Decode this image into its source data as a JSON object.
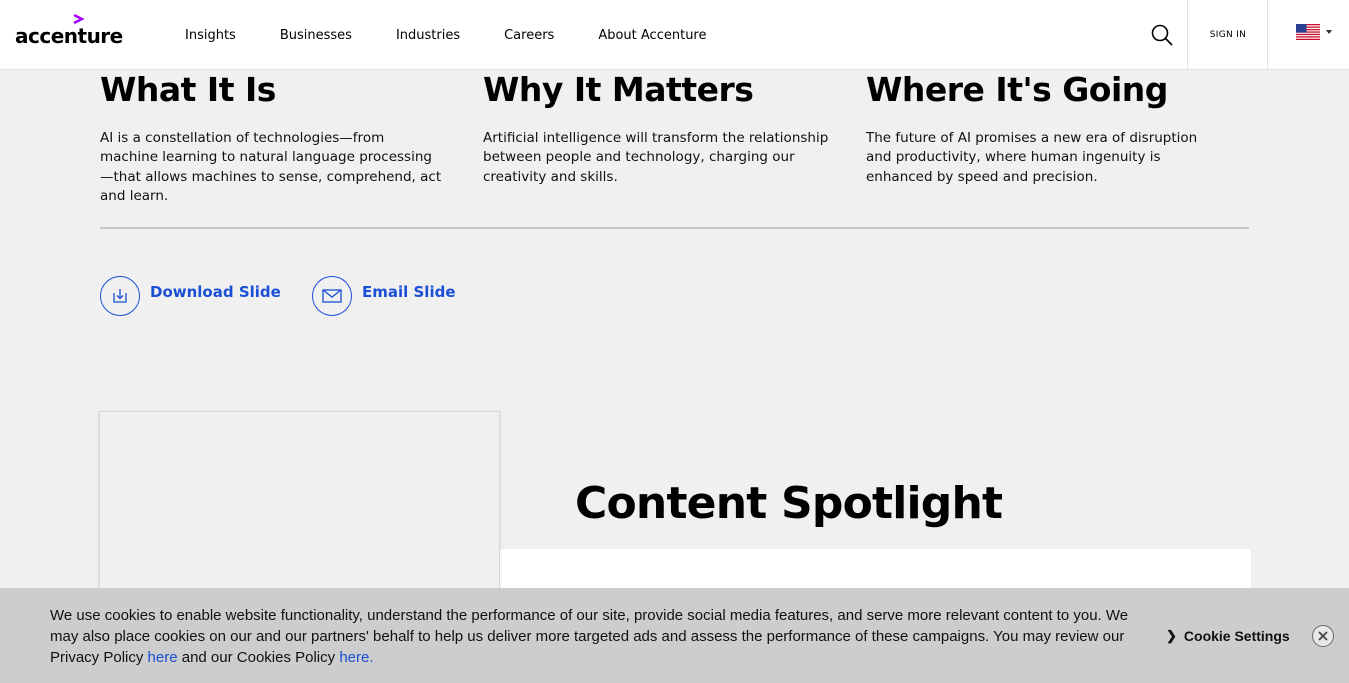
{
  "header": {
    "logo_text": "accenture",
    "nav": [
      "Insights",
      "Businesses",
      "Industries",
      "Careers",
      "About Accenture"
    ],
    "sign_in": "SIGN IN",
    "brand_color": "#a100ff"
  },
  "columns": [
    {
      "title": "What It Is",
      "body": "AI is a constellation of technologies—from machine learning to natural language processing—that allows machines to sense, comprehend, act and learn."
    },
    {
      "title": "Why It Matters",
      "body": "Artificial intelligence will transform the relationship between people and technology, charging our creativity and skills."
    },
    {
      "title": "Where It's Going",
      "body": "The future of AI promises a new era of disruption and productivity, where human ingenuity is enhanced by speed and precision."
    }
  ],
  "actions": {
    "download_label": "Download Slide",
    "email_label": "Email Slide",
    "link_color": "#1a4fd6"
  },
  "spotlight": {
    "title": "Content Spotlight"
  },
  "cookie_banner": {
    "text_before": "We use cookies to enable website functionality, understand the performance of our site, provide social media features, and serve more relevant content to you. We may also place cookies on our and our partners' behalf to help us deliver more targeted ads and assess the performance of these campaigns. You may review our Privacy Policy ",
    "link1": "here",
    "text_middle": " and our Cookies Policy ",
    "link2": "here.",
    "settings_label": "Cookie Settings"
  }
}
